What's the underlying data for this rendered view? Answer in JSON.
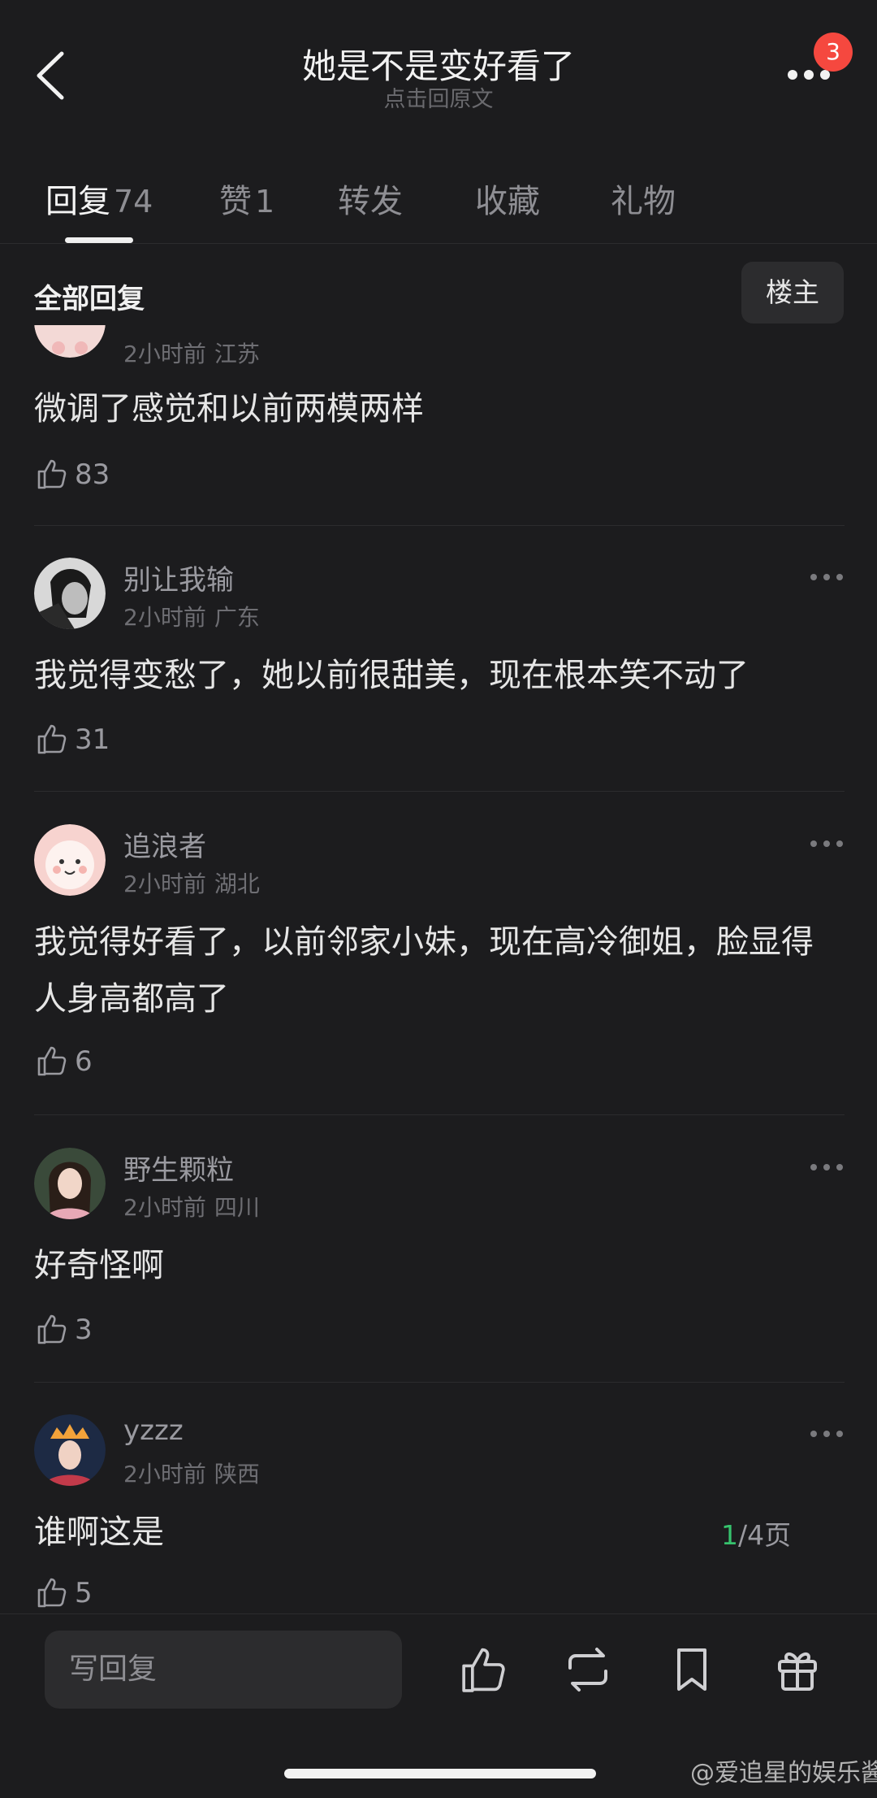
{
  "header": {
    "title": "她是不是变好看了",
    "subtitle": "点击回原文",
    "notification_count": "3"
  },
  "tabs": [
    {
      "label": "回复",
      "count": "74",
      "active": true
    },
    {
      "label": "赞",
      "count": "1",
      "active": false
    },
    {
      "label": "转发",
      "count": "",
      "active": false
    },
    {
      "label": "收藏",
      "count": "",
      "active": false
    },
    {
      "label": "礼物",
      "count": "",
      "active": false
    }
  ],
  "section": {
    "title": "全部回复",
    "owner_filter": "楼主"
  },
  "comments": [
    {
      "username": "",
      "time": "2小时前",
      "location": "江苏",
      "text": "微调了感觉和以前两模两样",
      "likes": "83"
    },
    {
      "username": "别让我输",
      "time": "2小时前",
      "location": "广东",
      "text": "我觉得变愁了，她以前很甜美，现在根本笑不动了",
      "likes": "31"
    },
    {
      "username": "追浪者",
      "time": "2小时前",
      "location": "湖北",
      "text": "我觉得好看了，以前邻家小妹，现在高冷御姐，脸显得人身高都高了",
      "likes": "6"
    },
    {
      "username": "野生颗粒",
      "time": "2小时前",
      "location": "四川",
      "text": "好奇怪啊",
      "likes": "3"
    },
    {
      "username": "yzzz",
      "time": "2小时前",
      "location": "陕西",
      "text": "谁啊这是",
      "likes": "5"
    }
  ],
  "pager": {
    "current": "1",
    "total": "/4页"
  },
  "bottom_bar": {
    "reply_placeholder": "写回复",
    "icons": [
      "like-icon",
      "repost-icon",
      "bookmark-icon",
      "gift-icon"
    ]
  },
  "watermark": "@爱追星的娱乐酱",
  "colors": {
    "background": "#1c1c1e",
    "badge": "#f5483f",
    "pager_accent": "#36c26d"
  }
}
